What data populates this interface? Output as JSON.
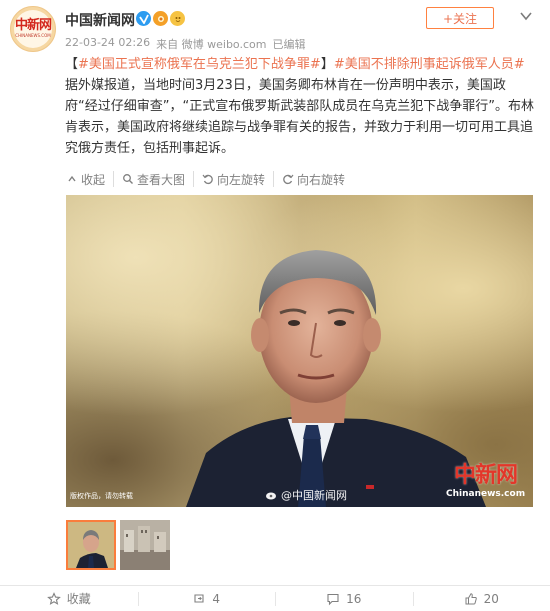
{
  "user": {
    "name": "中国新闻网",
    "avatar_logo": "中新网",
    "avatar_sub": "CHINANEWS.COM"
  },
  "meta": {
    "time": "22-03-24 02:26",
    "source": "来自 微博 weibo.com",
    "edited": "已编辑"
  },
  "follow_label": "+关注",
  "post": {
    "bracket_open": "【",
    "topic1": "#美国正式宣称俄军在乌克兰犯下战争罪#",
    "bracket_close": "】",
    "topic2": "#美国不排除刑事起诉俄军人员#",
    "text": "据外媒报道，当地时间3月23日，美国务卿布林肯在一份声明中表示，美国政府“经过仔细审查”，“正式宣布俄罗斯武装部队成员在乌克兰犯下战争罪行”。布林肯表示，美国政府将继续追踪与战争罪有关的报告，并致力于利用一切可用工具追究俄方责任，包括刑事起诉。"
  },
  "toolbar": {
    "collapse": "收起",
    "view_large": "查看大图",
    "rotate_left": "向左旋转",
    "rotate_right": "向右旋转"
  },
  "photo": {
    "caption_left": "版权作品，请勿转载",
    "watermark": "@中国新闻网",
    "logo_cn": "中新网",
    "logo_en": "Chinanews.com"
  },
  "actions": {
    "favorite": "收藏",
    "repost_count": "4",
    "comment_count": "16",
    "like_count": "20"
  },
  "colors": {
    "accent": "#eb7350",
    "topic": "#eb7350",
    "verified": "#2d9cf0",
    "muted": "#808080"
  }
}
